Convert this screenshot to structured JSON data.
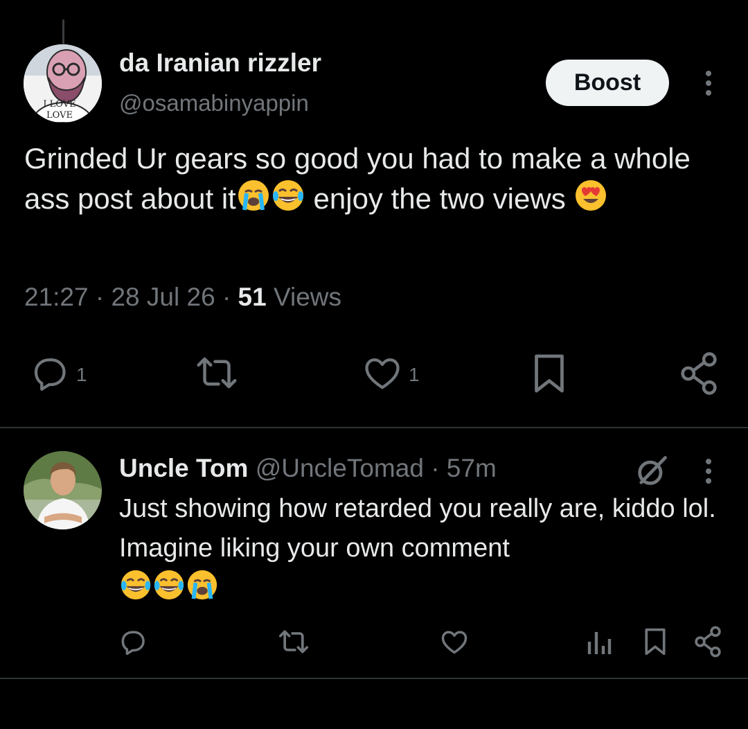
{
  "main_post": {
    "author_name": "da Iranian rizzler",
    "author_handle": "@osamabinyappin",
    "avatar_text_line1": "I LOVE",
    "avatar_text_line2": "LOVE",
    "boost_label": "Boost",
    "text_part1": "Grinded Ur gears so good you had to make a whole ass post about it",
    "text_part2": " enjoy the two views ",
    "time": "21:27",
    "date": "28 Jul 26",
    "views_count": "51",
    "views_label": "Views",
    "separator": "·",
    "reply_count": "1",
    "like_count": "1"
  },
  "reply": {
    "author_name": "Uncle Tom",
    "author_handle": "@UncleTomad",
    "separator": "·",
    "time": "57m",
    "text": "Just showing how retarded you really are, kiddo lol. Imagine liking your own comment"
  },
  "icons": {
    "reply": "speech-bubble-icon",
    "repost": "repost-arrows-icon",
    "like": "heart-icon",
    "bookmark": "bookmark-icon",
    "share": "share-nodes-icon",
    "analytics": "bar-chart-icon",
    "grok": "grok-slash-circle-icon",
    "more": "vertical-dots-icon"
  },
  "colors": {
    "background": "#000000",
    "text_primary": "#e7e9ea",
    "text_secondary": "#71767b",
    "divider": "#2f3336",
    "boost_bg": "#eff3f4"
  }
}
